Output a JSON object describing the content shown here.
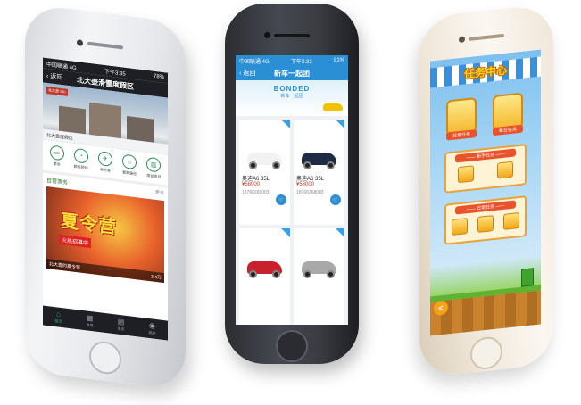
{
  "phone1": {
    "status": {
      "carrier": "中国联通 4G",
      "time": "下午3:35",
      "battery": "78%"
    },
    "nav": {
      "back": "返回",
      "title": "北大壶滑雪度假区"
    },
    "hero": {
      "tag": "北大壶 SKI",
      "caption": "北大壶度假区"
    },
    "icons": [
      {
        "glyph": "▭",
        "label": "票务"
      },
      {
        "glyph": "◔",
        "label": "教练预约"
      },
      {
        "glyph": "✈",
        "label": "单分客"
      },
      {
        "glyph": "⌂",
        "label": "看肤路径"
      },
      {
        "glyph": "▥",
        "label": "度台项目"
      }
    ],
    "section": {
      "title": "自营票务",
      "more": "更多"
    },
    "promo": {
      "headline": "夏令营",
      "band": "火热招募中",
      "footer_left": "北大壶的夏令营",
      "footer_right": "3,4万"
    },
    "tabs": [
      {
        "glyph": "⌂",
        "label": "首页"
      },
      {
        "glyph": "▦",
        "label": "发现"
      },
      {
        "glyph": "▤",
        "label": "资讯"
      },
      {
        "glyph": "◉",
        "label": "我的"
      }
    ]
  },
  "phone2": {
    "status": {
      "carrier": "中国联通 4G",
      "time": "下午3:32",
      "battery": "81%"
    },
    "nav": {
      "back": "返回",
      "title": "新车一起团"
    },
    "hero": {
      "brand": "BONDED",
      "sub": "新车一起团"
    },
    "cars": [
      {
        "name": "奥迪A6 35L",
        "price": "¥58000",
        "phone": "18766268003",
        "color": "#f2f2f2"
      },
      {
        "name": "奥迪A6 35L",
        "price": "¥58000",
        "phone": "18766268003",
        "color": "#1f2a44"
      },
      {
        "name": "",
        "price": "",
        "phone": "",
        "color": "#c8202c"
      },
      {
        "name": "",
        "price": "",
        "phone": "",
        "color": "#a9a9a9"
      }
    ],
    "cart_icon": "cart-icon"
  },
  "phone3": {
    "title": "任务中心",
    "tasks": [
      "日常任务",
      "每日任务"
    ],
    "panels": [
      {
        "header": "—— 新手任务 ——"
      },
      {
        "header": "—— 日常任务 ——"
      }
    ],
    "arrow": "<"
  }
}
